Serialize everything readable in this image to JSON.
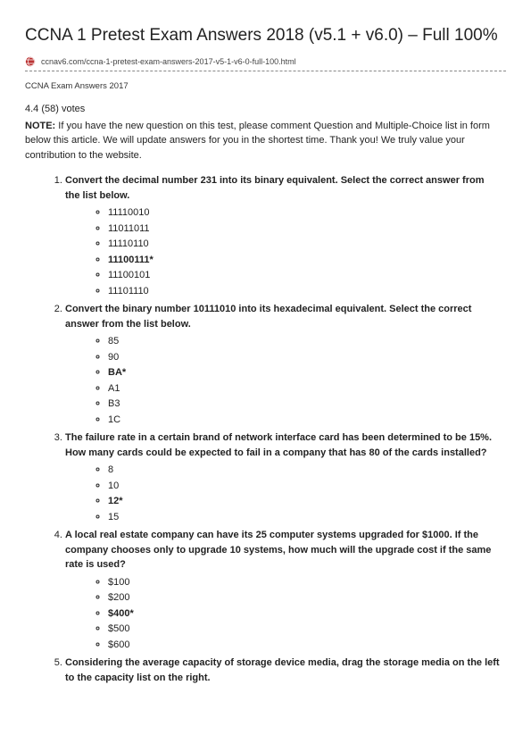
{
  "title": "CCNA 1 Pretest Exam Answers 2018 (v5.1 + v6.0) – Full 100%",
  "url": "ccnav6.com/ccna-1-pretest-exam-answers-2017-v5-1-v6-0-full-100.html",
  "breadcrumb": "CCNA Exam Answers 2017",
  "rating": "4.4 (58) votes",
  "note_label": "NOTE:",
  "note_body": " If you have the new question on this test, please comment Question and Multiple-Choice list in form below this article. We will update answers for you in the shortest time. Thank you! We truly value your contribution to the website.",
  "questions": [
    {
      "text": "Convert the decimal number 231 into its binary equivalent. Select the correct answer from the list below.",
      "options": [
        "11110010",
        "11011011",
        "11110110",
        "11100111*",
        "11100101",
        "11101110"
      ],
      "correct": 3
    },
    {
      "text": "Convert the binary number 10111010 into its hexadecimal equivalent. Select the correct answer from the list below.",
      "options": [
        "85",
        "90",
        "BA*",
        "A1",
        "B3",
        "1C"
      ],
      "correct": 2
    },
    {
      "text": "The failure rate in a certain brand of network interface card has been determined to be 15%. How many cards could be expected to fail in a company that has 80 of the cards installed?",
      "options": [
        "8",
        "10",
        "12*",
        "15"
      ],
      "correct": 2
    },
    {
      "text": "A local real estate company can have its 25 computer systems upgraded for $1000. If the company chooses only to upgrade 10 systems, how much will the upgrade cost if the same rate is used?",
      "options": [
        "$100",
        "$200",
        "$400*",
        "$500",
        "$600"
      ],
      "correct": 2
    },
    {
      "text": "Considering the average capacity of storage device media, drag the storage media on the left to the capacity list on the right.",
      "options": []
    }
  ]
}
